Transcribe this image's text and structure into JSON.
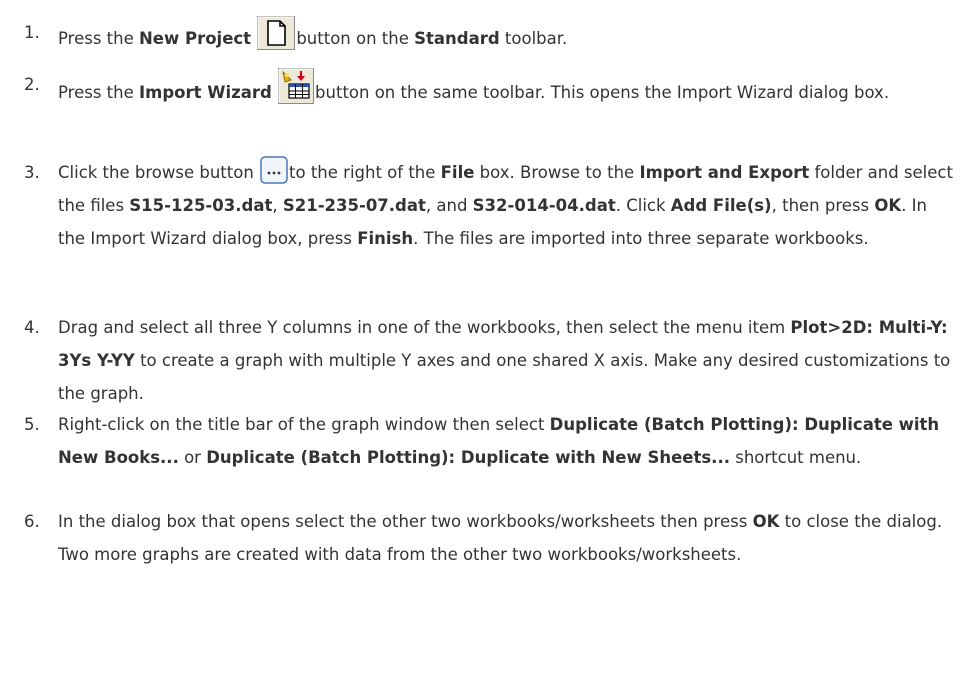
{
  "steps": [
    {
      "num": "1.",
      "segments": [
        {
          "t": "Press the "
        },
        {
          "b": "New Project"
        },
        {
          "t": " "
        },
        {
          "icon": "new-project-icon"
        },
        {
          "t": "button on the "
        },
        {
          "b": "Standard"
        },
        {
          "t": " toolbar."
        }
      ]
    },
    {
      "num": "2.",
      "segments": [
        {
          "t": "Press the "
        },
        {
          "b": "Import Wizard"
        },
        {
          "t": " "
        },
        {
          "icon": "import-wizard-icon"
        },
        {
          "t": "button on the same toolbar. This opens the Import Wizard dialog box."
        }
      ]
    },
    {
      "num": "3.",
      "segments": [
        {
          "t": "Click the browse button "
        },
        {
          "icon": "browse-icon"
        },
        {
          "t": "to the right of the "
        },
        {
          "b": "File"
        },
        {
          "t": " box. Browse to the "
        },
        {
          "b": "Import and Export"
        },
        {
          "t": " folder and select the files "
        },
        {
          "b": "S15-125-03.dat"
        },
        {
          "t": ", "
        },
        {
          "b": "S21-235-07.dat"
        },
        {
          "t": ", and "
        },
        {
          "b": "S32-014-04.dat"
        },
        {
          "t": ". Click "
        },
        {
          "b": "Add File(s)"
        },
        {
          "t": ", then press "
        },
        {
          "b": "OK"
        },
        {
          "t": ". In the Import Wizard dialog box, press "
        },
        {
          "b": "Finish"
        },
        {
          "t": ". The files are imported into three separate workbooks."
        }
      ]
    },
    {
      "num": "4.",
      "segments": [
        {
          "t": "Drag and select all three Y columns in one of the workbooks, then select the menu item "
        },
        {
          "b": "Plot>2D: Multi-Y: 3Ys Y-YY"
        },
        {
          "t": " to create a graph with multiple Y axes and one shared X axis. Make any desired customizations to the graph."
        }
      ]
    },
    {
      "num": "5.",
      "segments": [
        {
          "t": "Right-click on the title bar of the graph window then select "
        },
        {
          "b": "Duplicate (Batch Plotting): Duplicate with New Books..."
        },
        {
          "t": " or "
        },
        {
          "b": "Duplicate (Batch Plotting): Duplicate with New Sheets..."
        },
        {
          "t": " shortcut menu."
        }
      ]
    },
    {
      "num": "6.",
      "segments": [
        {
          "t": "In the dialog box that opens select the other two workbooks/worksheets then press "
        },
        {
          "b": "OK"
        },
        {
          "t": " to close the dialog. Two more graphs are created with data from the other two workbooks/worksheets."
        }
      ]
    }
  ]
}
